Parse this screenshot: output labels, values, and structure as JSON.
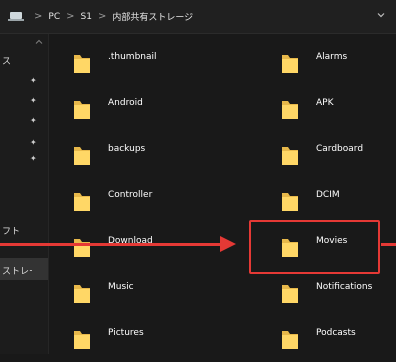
{
  "breadcrumb": {
    "items": [
      "PC",
      "S1",
      "内部共有ストレージ"
    ],
    "separator": ">"
  },
  "sidebar": {
    "items": [
      {
        "label": "ス",
        "pinned": true
      },
      {
        "label": "",
        "pinned": true
      },
      {
        "label": "",
        "pinned": true
      },
      {
        "label": "",
        "pinned": true
      },
      {
        "label": "",
        "pinned": true
      },
      {
        "label": "フト",
        "pinned": false
      },
      {
        "label": "ストレー",
        "pinned": false,
        "selected": true
      }
    ]
  },
  "folders": [
    {
      "name": ".thumbnail"
    },
    {
      "name": "Alarms"
    },
    {
      "name": "Android"
    },
    {
      "name": "APK"
    },
    {
      "name": "backups"
    },
    {
      "name": "Cardboard"
    },
    {
      "name": "Controller"
    },
    {
      "name": "DCIM"
    },
    {
      "name": "Download"
    },
    {
      "name": "Movies"
    },
    {
      "name": "Music"
    },
    {
      "name": "Notifications"
    },
    {
      "name": "Pictures"
    },
    {
      "name": "Podcasts"
    }
  ],
  "highlight": {
    "folder": "Movies",
    "color": "#e53935"
  },
  "colors": {
    "folder": "#ffd766",
    "folder_dark": "#e7b84a",
    "background": "#191919",
    "accent": "#e53935"
  },
  "icons": {
    "location": "pc-icon",
    "dropdown": "chevron-down-icon",
    "pin": "pin-icon",
    "folder": "folder-icon"
  }
}
